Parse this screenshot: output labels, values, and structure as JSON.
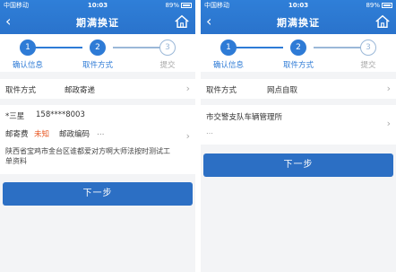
{
  "status": {
    "carrier": "中国移动",
    "time": "10:03",
    "battery": "89%"
  },
  "header": {
    "back": "‹",
    "title": "期满换证"
  },
  "steps": [
    {
      "num": "1",
      "label": "确认信息"
    },
    {
      "num": "2",
      "label": "取件方式"
    },
    {
      "num": "3",
      "label": "提交"
    }
  ],
  "left": {
    "method_label": "取件方式",
    "method_value": "邮政寄递",
    "name": "*三星",
    "phone": "158****8003",
    "postage_label": "邮寄费",
    "postage_value": "未知",
    "zip_label": "邮政编码",
    "zip_value": "…",
    "address": "陕西省宝鸡市金台区谁都爱对方啊大师法按时测试工单资料",
    "next_button": "下一步"
  },
  "right": {
    "method_label": "取件方式",
    "method_value": "网点自取",
    "office_name": "市交警支队车辆管理所",
    "office_address": "…",
    "next_button": "下一步"
  },
  "colors": {
    "primary": "#2c6fc4",
    "header": "#2f7fd8",
    "warning": "#e8541e"
  }
}
